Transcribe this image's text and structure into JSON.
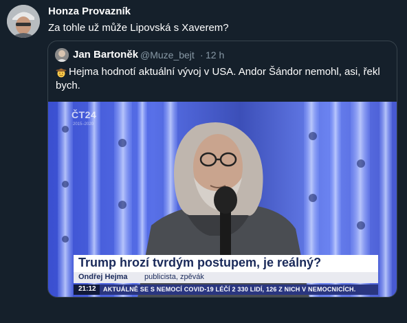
{
  "tweet": {
    "author": "Honza Provazník",
    "text": "Za tohle už může Lipovská s Xaverem?"
  },
  "quoted_tweet": {
    "name": "Jan Bartoněk",
    "handle": "@Muze_bejt",
    "separator": "·",
    "time": "12 h",
    "emoji": "cowboy-hat-face-emoji",
    "text_line1": "Hejma hodnotí aktuální vývoj v USA. Andor Šándor nemohl, asi, řekl",
    "text_line2": "bych."
  },
  "video_frame": {
    "channel_logo": "ČT24",
    "channel_sub": "2015–2020",
    "headline": "Trump hrozí tvrdým postupem, je reálný?",
    "person_name": "Ondřej Hejma",
    "person_role": "publicista, zpěvák",
    "ticker_time": "21:12",
    "ticker_text": "AKTUÁLNĚ SE S NEMOCÍ COVID-19 LÉČÍ 2 330 LIDÍ, 126 Z NICH V NEMOCNICÍCH."
  },
  "colors": {
    "background": "#15202b",
    "border": "#38444d",
    "muted_text": "#8899a6",
    "headline_text": "#1a2a5a",
    "ticker_bg": "#2a3680"
  }
}
